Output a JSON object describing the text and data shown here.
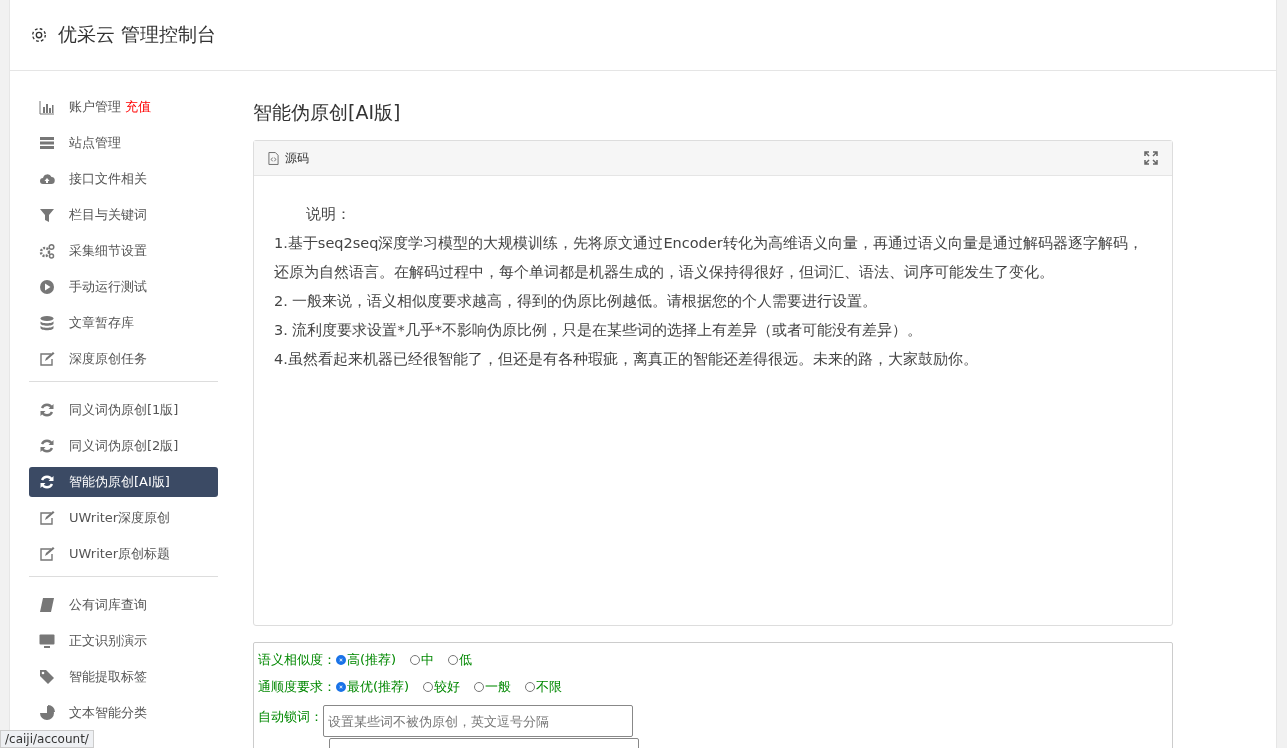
{
  "header": {
    "title": "优采云 管理控制台"
  },
  "sidebar": {
    "groups": [
      {
        "items": [
          {
            "label": "账户管理",
            "badge": "充值",
            "selected": false
          },
          {
            "label": "站点管理",
            "selected": false
          },
          {
            "label": "接口文件相关",
            "selected": false
          },
          {
            "label": "栏目与关键词",
            "selected": false
          },
          {
            "label": "采集细节设置",
            "selected": false
          },
          {
            "label": "手动运行测试",
            "selected": false
          },
          {
            "label": "文章暂存库",
            "selected": false
          },
          {
            "label": "深度原创任务",
            "selected": false
          }
        ]
      },
      {
        "items": [
          {
            "label": "同义词伪原创[1版]",
            "selected": false
          },
          {
            "label": "同义词伪原创[2版]",
            "selected": false
          },
          {
            "label": "智能伪原创[AI版]",
            "selected": true
          },
          {
            "label": "UWriter深度原创",
            "selected": false
          },
          {
            "label": "UWriter原创标题",
            "selected": false
          }
        ]
      },
      {
        "items": [
          {
            "label": "公有词库查询",
            "selected": false
          },
          {
            "label": "正文识别演示",
            "selected": false
          },
          {
            "label": "智能提取标签",
            "selected": false
          },
          {
            "label": "文本智能分类",
            "selected": false
          }
        ]
      }
    ]
  },
  "page_title": "智能伪原创[AI版]",
  "editor": {
    "toolbar_label": "源码",
    "paragraphs": [
      "说明：",
      "1.基于seq2seq深度学习模型的大规模训练，先将原文通过Encoder转化为高维语义向量，再通过语义向量是通过解码器逐字解码，还原为自然语言。在解码过程中，每个单词都是机器生成的，语义保持得很好，但词汇、语法、词序可能发生了变化。",
      "2. 一般来说，语义相似度要求越高，得到的伪原比例越低。请根据您的个人需要进行设置。",
      "3. 流利度要求设置*几乎*不影响伪原比例，只是在某些词的选择上有差异（或者可能没有差异）。",
      "4.虽然看起来机器已经很智能了，但还是有各种瑕疵，离真正的智能还差得很远。未来的路，大家鼓励你。"
    ]
  },
  "options": {
    "similarity": {
      "label": "语义相似度：",
      "choices": [
        {
          "label": "高(推荐)",
          "selected": true
        },
        {
          "label": "中",
          "selected": false
        },
        {
          "label": "低",
          "selected": false
        }
      ]
    },
    "fluency": {
      "label": "通顺度要求：",
      "choices": [
        {
          "label": "最优(推荐)",
          "selected": true
        },
        {
          "label": "较好",
          "selected": false
        },
        {
          "label": "一般",
          "selected": false
        },
        {
          "label": "不限",
          "selected": false
        }
      ]
    },
    "lock_words": {
      "label": "自动锁词：",
      "placeholder": "设置某些词不被伪原创，英文逗号分隔"
    }
  },
  "status_url": "/caiji/account/"
}
